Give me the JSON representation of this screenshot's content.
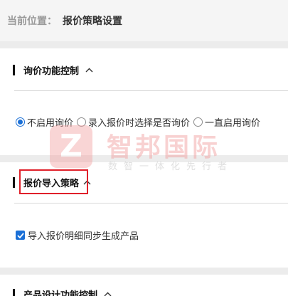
{
  "breadcrumb": {
    "label": "当前位置：",
    "current": "报价策略设置"
  },
  "sections": [
    {
      "title": "询价功能控制",
      "radio_options": [
        {
          "label": "不启用询价",
          "checked": true
        },
        {
          "label": "录入报价时选择是否询价",
          "checked": false
        },
        {
          "label": "一直启用询价",
          "checked": false
        }
      ]
    },
    {
      "title": "报价导入策略",
      "checkbox": {
        "label": "导入报价明细同步生成产品",
        "checked": true
      }
    },
    {
      "title": "产品设计功能控制"
    }
  ],
  "watermark": {
    "logo_letter": "Z",
    "title": "智邦国际",
    "subtitle": "数智一体化先行者"
  },
  "colors": {
    "accent": "#1a6fd6",
    "highlight": "#e0202a",
    "watermark": "#f19b9b"
  },
  "icons": {
    "chevron": "chevron-up-icon"
  }
}
